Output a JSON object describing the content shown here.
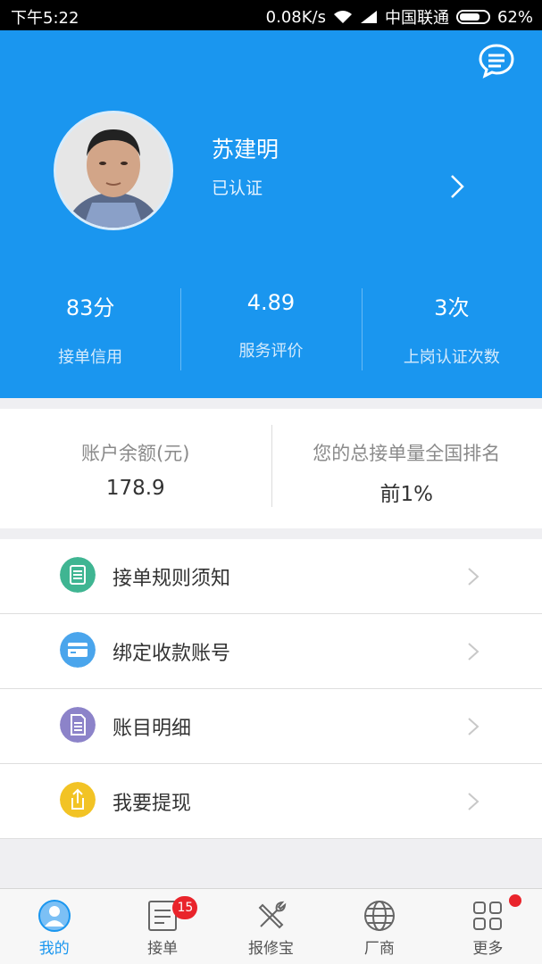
{
  "status_bar": {
    "time": "下午5:22",
    "speed": "0.08K/s",
    "carrier": "中国联通",
    "battery": "62%"
  },
  "profile": {
    "name": "苏建明",
    "verify_status": "已认证"
  },
  "stats": [
    {
      "value": "83分",
      "label": "接单信用"
    },
    {
      "value": "4.89",
      "label": "服务评价"
    },
    {
      "value": "3次",
      "label": "上岗认证次数"
    }
  ],
  "account": {
    "balance_label": "账户余额(元)",
    "balance_value": "178.9",
    "rank_label": "您的总接单量全国排名",
    "rank_value": "前1%"
  },
  "menu": [
    {
      "label": "接单规则须知",
      "icon": "rules-icon",
      "color": "#3fb592"
    },
    {
      "label": "绑定收款账号",
      "icon": "card-icon",
      "color": "#4aa5ec"
    },
    {
      "label": "账目明细",
      "icon": "ledger-icon",
      "color": "#8c83c9"
    },
    {
      "label": "我要提现",
      "icon": "withdraw-icon",
      "color": "#f2c325"
    }
  ],
  "tabbar": {
    "items": [
      {
        "label": "我的",
        "icon": "person-icon",
        "active": true
      },
      {
        "label": "接单",
        "icon": "orders-icon",
        "badge": "15"
      },
      {
        "label": "报修宝",
        "icon": "tools-icon"
      },
      {
        "label": "厂商",
        "icon": "globe-icon"
      },
      {
        "label": "更多",
        "icon": "grid-icon",
        "dot": true
      }
    ]
  },
  "colors": {
    "primary": "#1a96ef",
    "badge": "#e9242b"
  }
}
